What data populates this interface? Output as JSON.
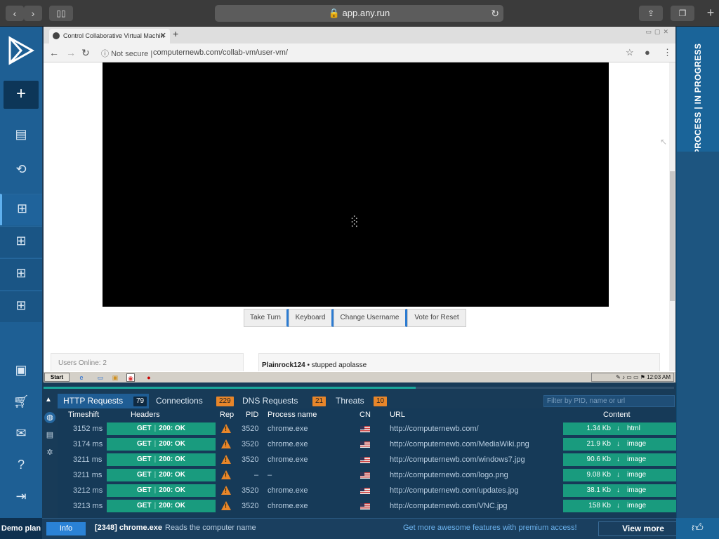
{
  "browser": {
    "url": "app.any.run",
    "back": "‹",
    "forward": "›"
  },
  "left_sidebar": {
    "plus": "+",
    "demo_plan": "Demo plan"
  },
  "vm_browser": {
    "tab_title": "Control Collaborative Virtual Machin",
    "not_secure": "Not secure",
    "address": "computernewb.com/collab-vm/user-vm/",
    "buttons": [
      "Take Turn",
      "Keyboard",
      "Change Username",
      "Vote for Reset"
    ],
    "users_online": "Users Online: 2",
    "chat_user": "Plainrock124",
    "chat_text": "stupped apolasse"
  },
  "xp_taskbar": {
    "start": "Start",
    "time": "12:03 AM"
  },
  "right_panel": {
    "label": "PROCESS | IN PROGRESS"
  },
  "bottom_panel": {
    "progress_fraction": 0.59,
    "tabs": [
      {
        "label": "HTTP Requests",
        "count": "79"
      },
      {
        "label": "Connections",
        "count": "229"
      },
      {
        "label": "DNS Requests",
        "count": "21"
      },
      {
        "label": "Threats",
        "count": "10"
      }
    ],
    "filter_placeholder": "Filter by PID, name or url",
    "columns": [
      "Timeshift",
      "Headers",
      "Rep",
      "PID",
      "Process name",
      "CN",
      "URL",
      "Content"
    ],
    "rows": [
      {
        "time": "3152 ms",
        "method": "GET",
        "status": "200: OK",
        "pid": "3520",
        "process": "chrome.exe",
        "url": "http://computernewb.com/",
        "size": "1.34 Kb",
        "type": "html"
      },
      {
        "time": "3174 ms",
        "method": "GET",
        "status": "200: OK",
        "pid": "3520",
        "process": "chrome.exe",
        "url": "http://computernewb.com/MediaWiki.png",
        "size": "21.9 Kb",
        "type": "image"
      },
      {
        "time": "3211 ms",
        "method": "GET",
        "status": "200: OK",
        "pid": "3520",
        "process": "chrome.exe",
        "url": "http://computernewb.com/windows7.jpg",
        "size": "90.6 Kb",
        "type": "image"
      },
      {
        "time": "3211 ms",
        "method": "GET",
        "status": "200: OK",
        "pid": "–",
        "process": "–",
        "url": "http://computernewb.com/logo.png",
        "size": "9.08 Kb",
        "type": "image"
      },
      {
        "time": "3212 ms",
        "method": "GET",
        "status": "200: OK",
        "pid": "3520",
        "process": "chrome.exe",
        "url": "http://computernewb.com/updates.jpg",
        "size": "38.1 Kb",
        "type": "image"
      },
      {
        "time": "3213 ms",
        "method": "GET",
        "status": "200: OK",
        "pid": "3520",
        "process": "chrome.exe",
        "url": "http://computernewb.com/VNC.jpg",
        "size": "158 Kb",
        "type": "image"
      }
    ]
  },
  "status_bar": {
    "info": "Info",
    "pid_process": "[2348] chrome.exe",
    "message": "Reads the computer name",
    "promo": "Get more awesome features with premium access!",
    "view_more": "View more"
  },
  "colors": {
    "accent": "#199b7e",
    "sidebar": "#1e5f94",
    "panel": "#183b58",
    "warning": "#e8862a",
    "info": "#2a82d6"
  }
}
